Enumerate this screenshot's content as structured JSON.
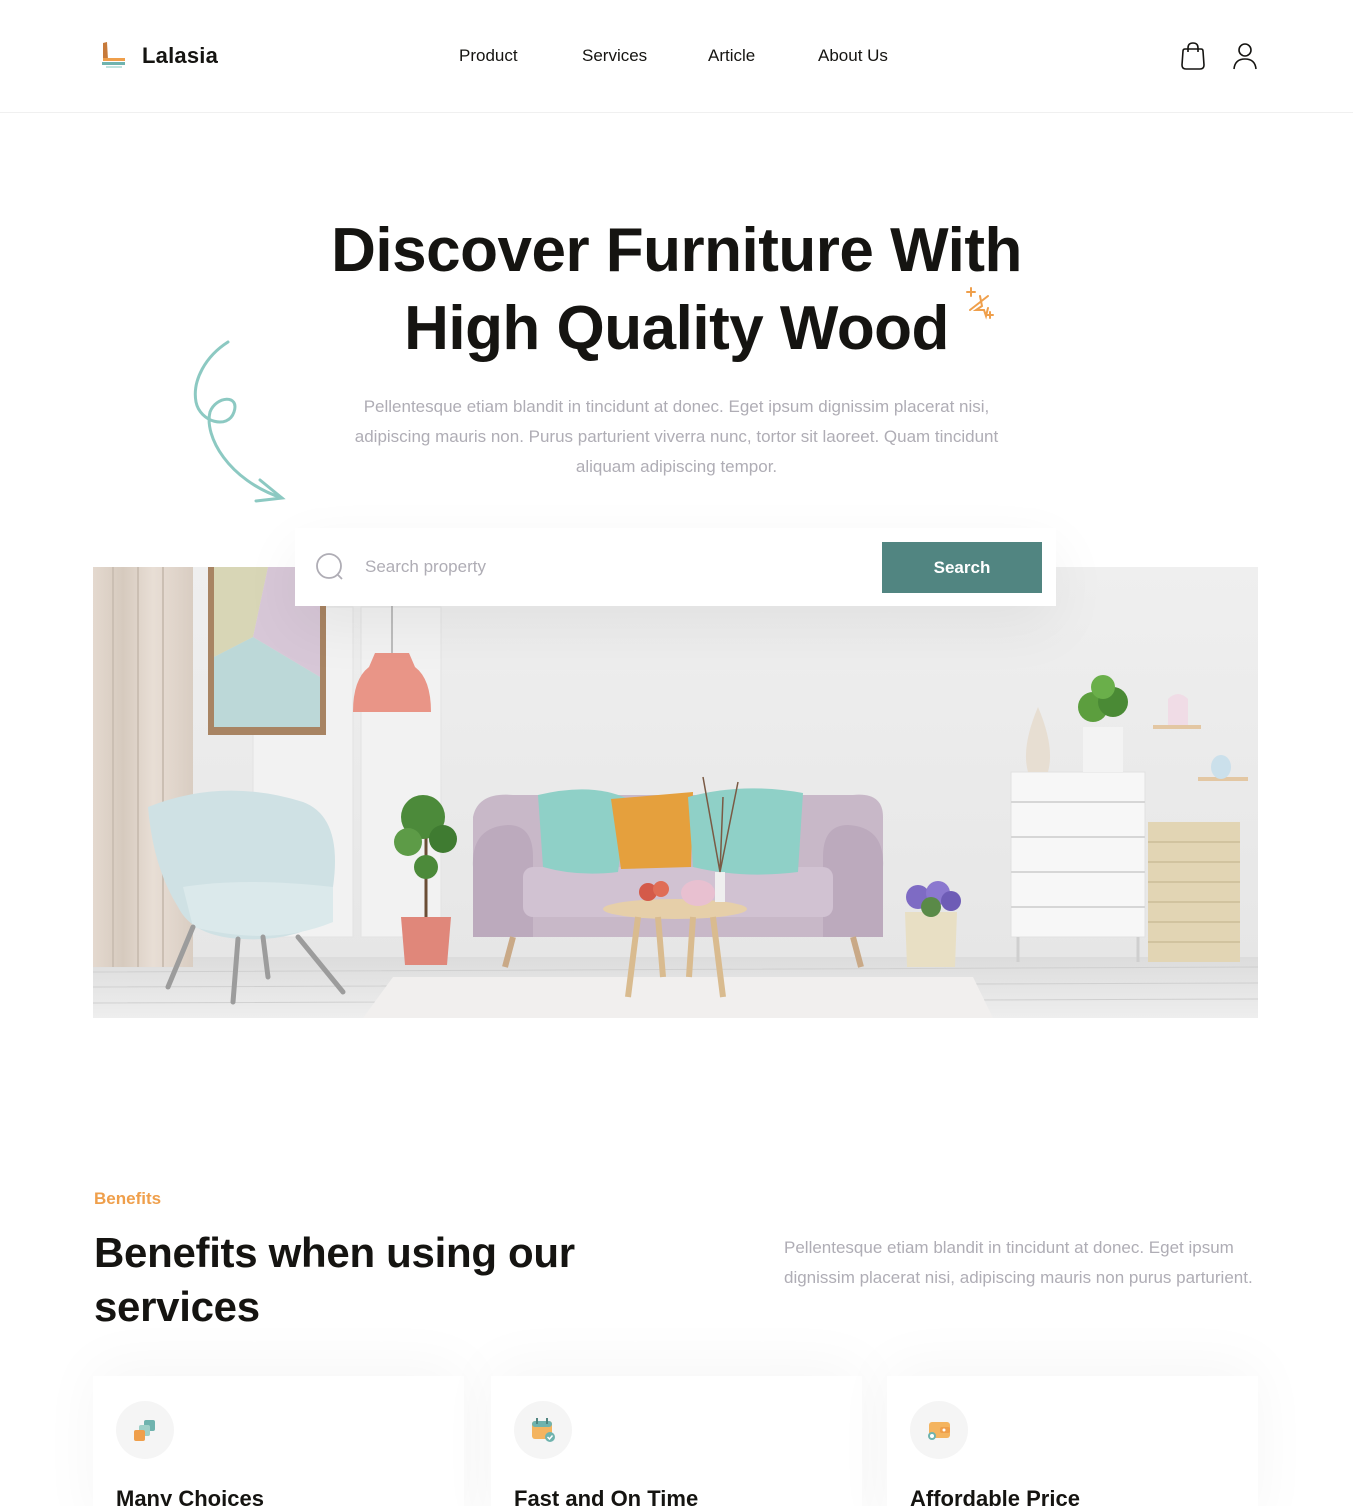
{
  "brand": {
    "name": "Lalasia"
  },
  "nav": {
    "items": [
      "Product",
      "Services",
      "Article",
      "About Us"
    ]
  },
  "header_icons": [
    "shopping-bag-icon",
    "user-icon"
  ],
  "hero": {
    "title_line1": "Discover Furniture With",
    "title_line2": "High Quality Wood",
    "description": "Pellentesque etiam blandit in tincidunt at donec. Eget ipsum dignissim placerat nisi, adipiscing mauris non. Purus parturient viverra nunc, tortor sit laoreet. Quam tincidunt aliquam adipiscing tempor."
  },
  "search": {
    "placeholder": "Search property",
    "value": "",
    "button_label": "Search"
  },
  "benefits": {
    "label": "Benefits",
    "title": "Benefits when using our services",
    "description": "Pellentesque etiam blandit in tincidunt at donec. Eget ipsum dignissim placerat nisi, adipiscing mauris non purus parturient.",
    "cards": [
      {
        "title": "Many Choices",
        "icon": "layers-icon"
      },
      {
        "title": "Fast and On Time",
        "icon": "calendar-check-icon"
      },
      {
        "title": "Affordable Price",
        "icon": "wallet-icon"
      }
    ]
  },
  "colors": {
    "primary": "#518581",
    "accent": "#ef9f4b",
    "title": "#151411",
    "paragraph": "#afadb5"
  }
}
